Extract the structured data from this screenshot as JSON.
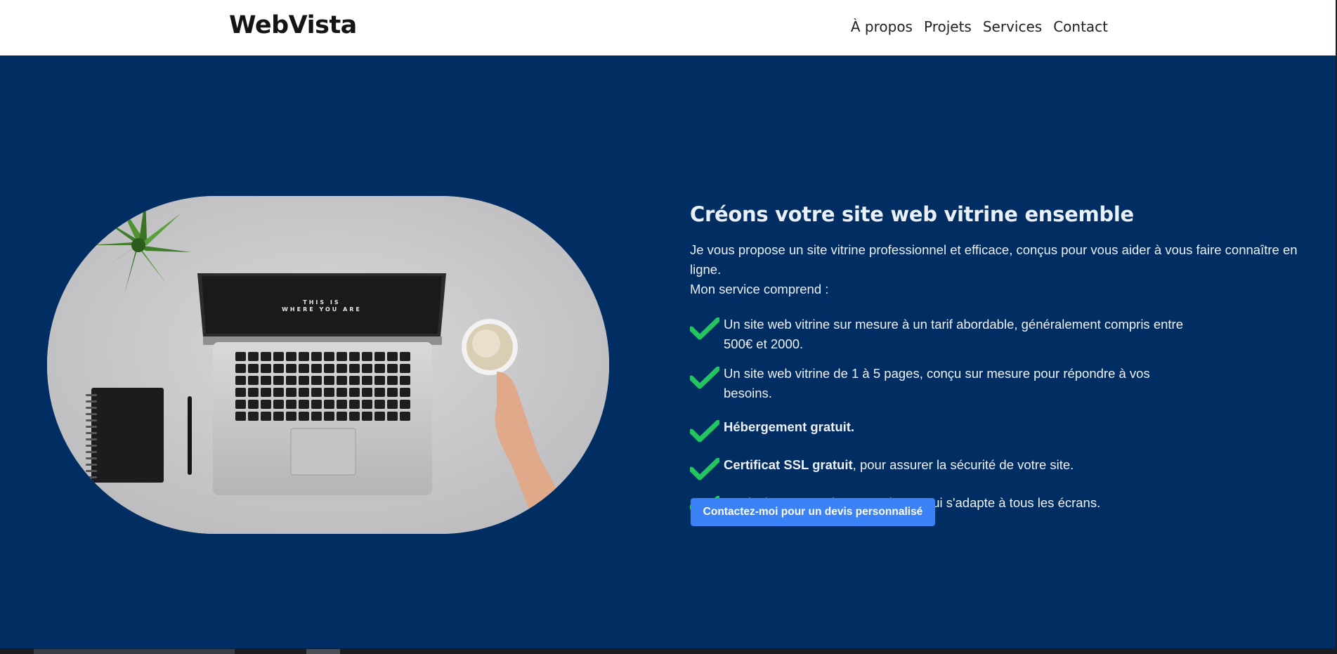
{
  "navbar": {
    "brand": "WebVista",
    "links": [
      "À propos",
      "Projets",
      "Services",
      "Contact"
    ]
  },
  "hero": {
    "image_alt": "Ordinateur portable, carnet, stylo, plante et tasse de café sur un bureau",
    "laptop_screen_text": [
      "THIS IS",
      "WHERE YOU ARE"
    ],
    "title": "Créons votre site web vitrine ensemble",
    "intro_line1": "Je vous propose un site vitrine professionnel et efficace, conçus pour vous aider à vous faire connaître en ligne.",
    "intro_line2": "Mon service comprend :",
    "features": [
      {
        "text": "Un site web vitrine sur mesure à un tarif abordable, généralement compris entre 500€ et 2000."
      },
      {
        "text": "Un site web vitrine de 1 à 5 pages, conçu sur mesure pour répondre à vos besoins."
      },
      {
        "bold": "Hébergement gratuit.",
        "text": ""
      },
      {
        "bold": "Certificat SSL gratuit",
        "text": ", pour assurer la sécurité de votre site."
      },
      {
        "text": "Un design responsive et moderne, qui s'adapte à tous les écrans."
      }
    ],
    "cta_label": "Contactez-moi pour un devis personnalisé"
  },
  "colors": {
    "hero_background": "#002d62",
    "check": "#22c55e",
    "button": "#3b82f6"
  },
  "icons": {
    "feature_icon": "check-icon"
  }
}
